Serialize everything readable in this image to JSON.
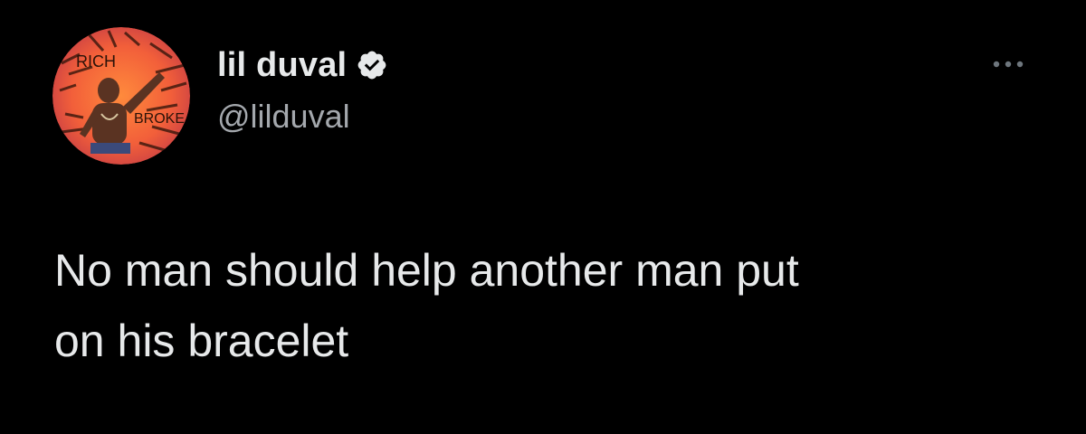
{
  "author": {
    "display_name": "lil duval",
    "handle": "@lilduval",
    "verified": true,
    "verified_icon": "verified-badge-icon",
    "avatar_description": "avatar",
    "avatar_lettering": [
      "RICH",
      "BROKE"
    ]
  },
  "tweet": {
    "text": "No man should help another man put\non his bracelet"
  },
  "actions": {
    "more_icon": "more-horizontal-icon"
  },
  "colors": {
    "background": "#000000",
    "primary_text": "#e7e9ea",
    "secondary_text": "#a4a8ad",
    "badge_fill": "#e7e9ea",
    "badge_check": "#000000"
  }
}
